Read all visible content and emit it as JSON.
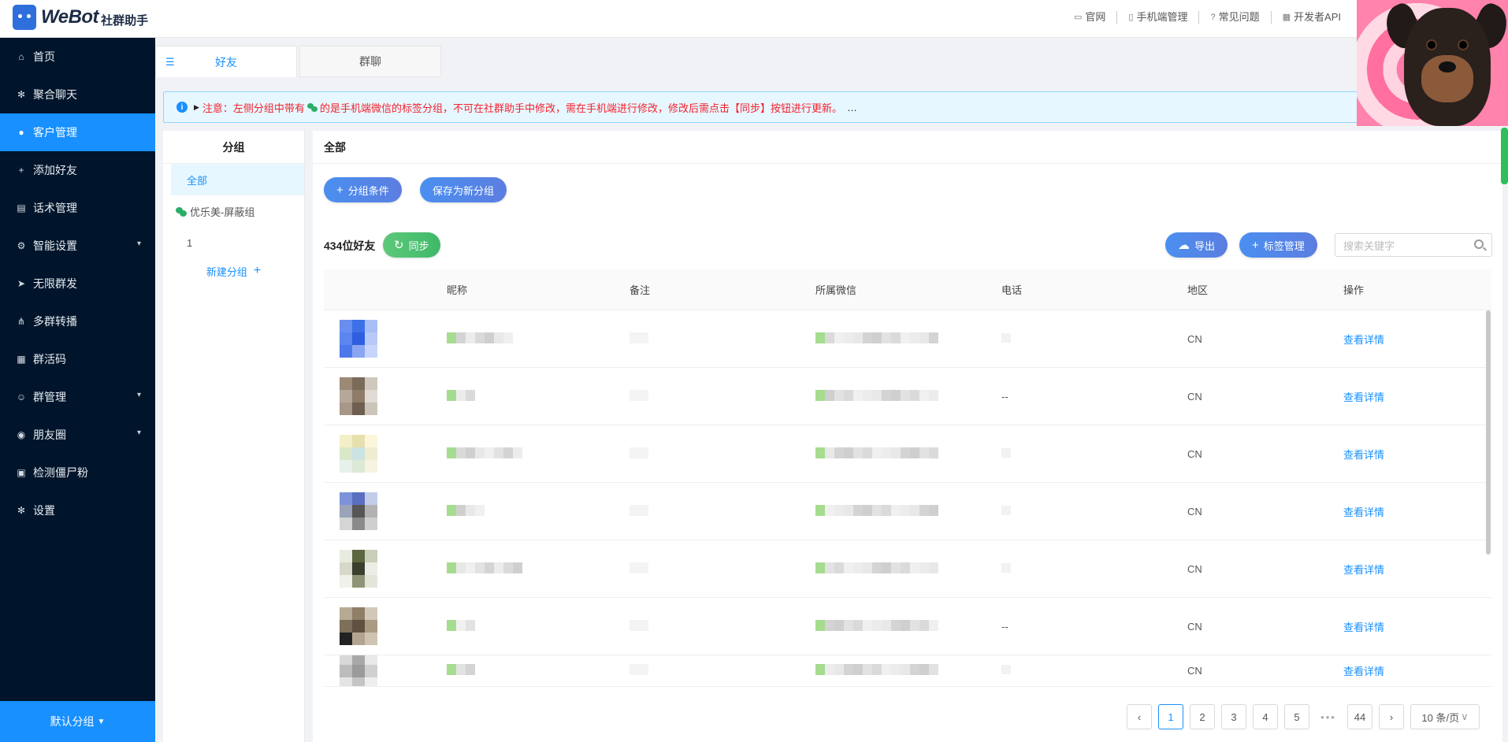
{
  "brand": {
    "name": "WeBot",
    "subtitle": "社群助手"
  },
  "toplinks": [
    {
      "label": "官网",
      "icon": "monitor-icon"
    },
    {
      "label": "手机端管理",
      "icon": "phone-icon"
    },
    {
      "label": "常见问题",
      "icon": "question-icon"
    },
    {
      "label": "开发者API",
      "icon": "api-icon"
    }
  ],
  "sidebar": {
    "items": [
      {
        "label": "首页",
        "icon": "home-icon",
        "active": false
      },
      {
        "label": "聚合聊天",
        "icon": "gear-icon",
        "active": false
      },
      {
        "label": "客户管理",
        "icon": "user-icon",
        "active": true
      },
      {
        "label": "添加好友",
        "icon": "user-add-icon",
        "active": false
      },
      {
        "label": "话术管理",
        "icon": "doc-icon",
        "active": false
      },
      {
        "label": "智能设置",
        "icon": "settings-icon",
        "active": false,
        "expandable": true
      },
      {
        "label": "无限群发",
        "icon": "send-icon",
        "active": false
      },
      {
        "label": "多群转播",
        "icon": "broadcast-icon",
        "active": false
      },
      {
        "label": "群活码",
        "icon": "qrcode-icon",
        "active": false
      },
      {
        "label": "群管理",
        "icon": "group-icon",
        "active": false,
        "expandable": true
      },
      {
        "label": "朋友圈",
        "icon": "moments-icon",
        "active": false,
        "expandable": true
      },
      {
        "label": "检测僵尸粉",
        "icon": "check-icon",
        "active": false
      },
      {
        "label": "设置",
        "icon": "gear-icon",
        "active": false
      }
    ],
    "bottom": "默认分组"
  },
  "tabs": [
    {
      "label": "好友",
      "active": true
    },
    {
      "label": "群聊",
      "active": false
    }
  ],
  "alert": {
    "prefix": "注意：左侧分组中带有",
    "suffix": "的是手机端微信的标签分组，不可在社群助手中修改，需在手机端进行修改，修改后需点击【同步】按钮进行更新。",
    "more": "…"
  },
  "groups": {
    "title": "分组",
    "items": [
      "全部",
      "优乐美-屏蔽组",
      "1"
    ],
    "new_label": "新建分组"
  },
  "main": {
    "title": "全部",
    "filter_button": "分组条件",
    "save_button": "保存为新分组",
    "friend_count": "434位好友",
    "sync_button": "同步",
    "export_button": "导出",
    "tag_button": "标签管理",
    "search_placeholder": "搜索关键字"
  },
  "table": {
    "headers": [
      "昵称",
      "备注",
      "所属微信",
      "电话",
      "地区",
      "操作"
    ],
    "rows": [
      {
        "phone": "",
        "region": "CN",
        "action": "查看详情"
      },
      {
        "phone": "--",
        "region": "CN",
        "action": "查看详情"
      },
      {
        "phone": "",
        "region": "CN",
        "action": "查看详情"
      },
      {
        "phone": "",
        "region": "CN",
        "action": "查看详情"
      },
      {
        "phone": "",
        "region": "CN",
        "action": "查看详情"
      },
      {
        "phone": "--",
        "region": "CN",
        "action": "查看详情"
      },
      {
        "phone": "",
        "region": "CN",
        "action": "查看详情"
      }
    ]
  },
  "pagination": {
    "pages": [
      "1",
      "2",
      "3",
      "4",
      "5"
    ],
    "ellipsis": "•••",
    "last": "44",
    "current": "1",
    "page_size": "10 条/页"
  },
  "colors": {
    "sidebar_bg": "#00152b",
    "accent": "#1890ff",
    "alert_text": "#f5222d",
    "sync_green": "#3eb968"
  }
}
